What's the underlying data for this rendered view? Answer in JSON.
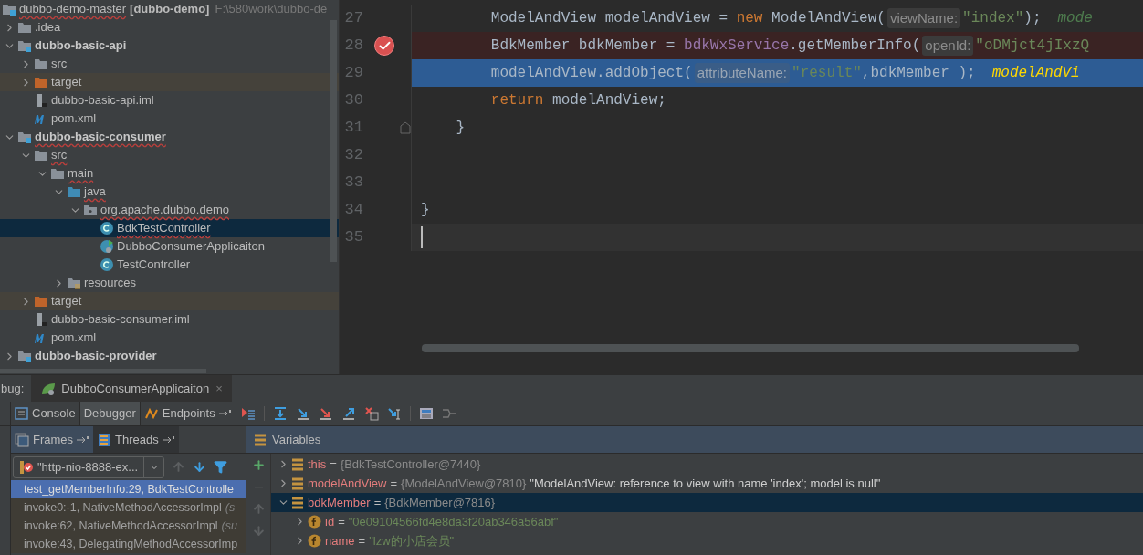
{
  "project": {
    "root": {
      "name": "dubbo-demo-master",
      "module": "[dubbo-demo]",
      "path": "F:\\580work\\dubbo-de",
      "error": true
    },
    "items": [
      {
        "name": ".idea",
        "kind": "folder",
        "bold": false,
        "error": false,
        "expanded": false,
        "selected": false
      },
      {
        "name": "dubbo-basic-api",
        "kind": "module",
        "bold": true,
        "error": false,
        "expanded": true,
        "selected": false,
        "children": [
          {
            "name": "src",
            "kind": "folder",
            "bold": false,
            "error": false,
            "expanded": false,
            "selected": false
          },
          {
            "name": "target",
            "kind": "excluded",
            "bold": false,
            "error": false,
            "expanded": false,
            "selected": false
          },
          {
            "name": "dubbo-basic-api.iml",
            "kind": "iml",
            "bold": false,
            "error": false,
            "selected": false
          },
          {
            "name": "pom.xml",
            "kind": "maven",
            "bold": false,
            "error": false,
            "selected": false
          }
        ]
      },
      {
        "name": "dubbo-basic-consumer",
        "kind": "module",
        "bold": true,
        "error": true,
        "expanded": true,
        "selected": false,
        "children": [
          {
            "name": "src",
            "kind": "folder",
            "bold": false,
            "error": true,
            "expanded": true,
            "selected": false,
            "children": [
              {
                "name": "main",
                "kind": "folder",
                "bold": false,
                "error": true,
                "expanded": true,
                "selected": false,
                "children": [
                  {
                    "name": "java",
                    "kind": "source",
                    "bold": false,
                    "error": true,
                    "expanded": true,
                    "selected": false,
                    "children": [
                      {
                        "name": "org.apache.dubbo.demo",
                        "kind": "package",
                        "bold": false,
                        "error": true,
                        "expanded": true,
                        "selected": false,
                        "children": [
                          {
                            "name": "BdkTestController",
                            "kind": "class",
                            "bold": false,
                            "error": true,
                            "selected": true
                          },
                          {
                            "name": "DubboConsumerApplicaiton",
                            "kind": "spring-class",
                            "bold": false,
                            "error": false,
                            "selected": false
                          },
                          {
                            "name": "TestController",
                            "kind": "class",
                            "bold": false,
                            "error": false,
                            "selected": false
                          }
                        ]
                      }
                    ]
                  },
                  {
                    "name": "resources",
                    "kind": "resources",
                    "bold": false,
                    "error": false,
                    "expanded": false,
                    "selected": false
                  }
                ]
              }
            ]
          },
          {
            "name": "target",
            "kind": "excluded",
            "bold": false,
            "error": false,
            "expanded": false,
            "selected": false
          },
          {
            "name": "dubbo-basic-consumer.iml",
            "kind": "iml",
            "bold": false,
            "error": false,
            "selected": false
          },
          {
            "name": "pom.xml",
            "kind": "maven",
            "bold": false,
            "error": false,
            "selected": false
          }
        ]
      },
      {
        "name": "dubbo-basic-provider",
        "kind": "module",
        "bold": true,
        "error": false,
        "expanded": false,
        "selected": false
      }
    ]
  },
  "editor": {
    "lines": [
      {
        "number": "27",
        "kind": "plain",
        "breakpoint": false,
        "fold": false,
        "segments": [
          {
            "kind": "plain",
            "text": "        ModelAndView modelAndView = "
          },
          {
            "kind": "keyword",
            "text": "new"
          },
          {
            "kind": "plain",
            "text": " ModelAndView("
          },
          {
            "kind": "hint",
            "text": "viewName:"
          },
          {
            "kind": "string",
            "text": "\"index\""
          },
          {
            "kind": "plain",
            "text": ");"
          },
          {
            "kind": "inline",
            "text": "mode"
          }
        ]
      },
      {
        "number": "28",
        "kind": "breakpoint",
        "breakpoint": true,
        "fold": false,
        "segments": [
          {
            "kind": "plain",
            "text": "        BdkMember bdkMember = "
          },
          {
            "kind": "field",
            "text": "bdkWxService"
          },
          {
            "kind": "plain",
            "text": ".getMemberInfo("
          },
          {
            "kind": "hint",
            "text": "openId:"
          },
          {
            "kind": "string",
            "text": "\"oDMjct4jIxzQ"
          }
        ]
      },
      {
        "number": "29",
        "kind": "execution",
        "breakpoint": false,
        "fold": false,
        "segments": [
          {
            "kind": "plain",
            "text": "        modelAndView.addObject("
          },
          {
            "kind": "hint",
            "text": "attributeName:"
          },
          {
            "kind": "string",
            "text": "\"result\""
          },
          {
            "kind": "plain",
            "text": ",bdkMember );"
          },
          {
            "kind": "inline",
            "text": "modelAndVi"
          }
        ]
      },
      {
        "number": "30",
        "kind": "plain",
        "breakpoint": false,
        "fold": false,
        "segments": [
          {
            "kind": "keyword",
            "text": "        return"
          },
          {
            "kind": "plain",
            "text": " modelAndView;"
          }
        ]
      },
      {
        "number": "31",
        "kind": "plain",
        "breakpoint": false,
        "fold": true,
        "segments": [
          {
            "kind": "plain",
            "text": "    }"
          }
        ]
      },
      {
        "number": "32",
        "kind": "plain",
        "breakpoint": false,
        "fold": false
      },
      {
        "number": "33",
        "kind": "plain",
        "breakpoint": false,
        "fold": false
      },
      {
        "number": "34",
        "kind": "plain",
        "breakpoint": false,
        "fold": false,
        "segments": [
          {
            "kind": "plain",
            "text": "}"
          }
        ]
      },
      {
        "number": "35",
        "kind": "caret",
        "breakpoint": false,
        "fold": false
      }
    ]
  },
  "debug": {
    "label": "bug:",
    "session": "DubboConsumerApplicaiton",
    "close": "×",
    "tabs": [
      {
        "label": "Console",
        "kind": "console",
        "selected": false,
        "pin": false
      },
      {
        "label": "Debugger",
        "kind": "plain",
        "selected": true,
        "pin": false
      },
      {
        "label": "Endpoints",
        "kind": "endpoints",
        "selected": false,
        "pin": true
      }
    ],
    "frames_tabs": [
      {
        "label": "Frames",
        "kind": "frames",
        "selected": true
      },
      {
        "label": "Threads",
        "kind": "threads",
        "selected": false
      }
    ],
    "thread": "\"http-nio-8888-ex...",
    "frames": [
      {
        "text": "test_getMemberInfo:29, BdkTestControlle",
        "selected": true
      },
      {
        "text": "invoke0:-1, NativeMethodAccessorImpl",
        "note": "(s",
        "selected": false
      },
      {
        "text": "invoke:62, NativeMethodAccessorImpl",
        "note": "(su",
        "selected": false
      },
      {
        "text": "invoke:43, DelegatingMethodAccessorImp",
        "selected": false
      }
    ],
    "variables_title": "Variables",
    "variables": [
      {
        "name": "this",
        "kind": "object",
        "operator": "=",
        "type": "{BdkTestController@7440}",
        "expanded": false,
        "selected": false
      },
      {
        "name": "modelAndView",
        "kind": "object",
        "operator": "=",
        "type": "{ModelAndView@7810}",
        "value": "\"ModelAndView: reference to view with name 'index'; model is null\"",
        "expanded": false,
        "selected": false
      },
      {
        "name": "bdkMember",
        "kind": "object",
        "operator": "=",
        "type": "{BdkMember@7816}",
        "expanded": true,
        "selected": true,
        "children": [
          {
            "name": "id",
            "kind": "field",
            "operator": "=",
            "value": "\"0e09104566fd4e8da3f20ab346a56abf\"",
            "expanded": false,
            "selected": false
          },
          {
            "name": "name",
            "kind": "field",
            "operator": "=",
            "value": "\"lzw的小店会员\"",
            "expanded": false,
            "selected": false
          }
        ]
      }
    ]
  }
}
